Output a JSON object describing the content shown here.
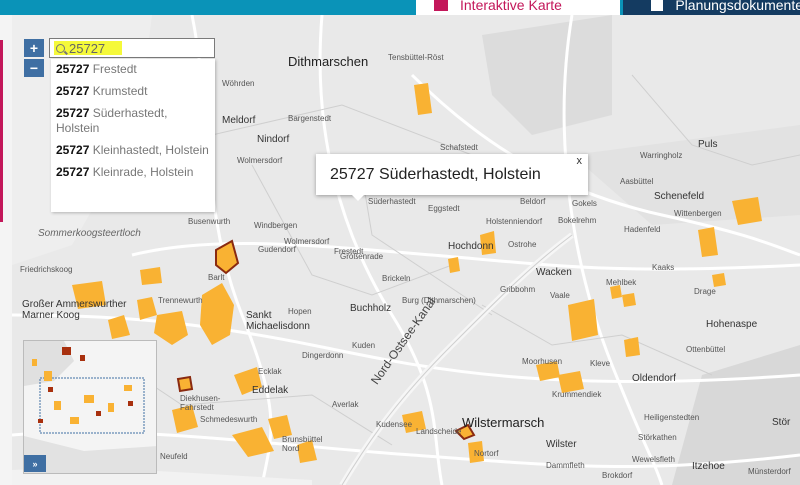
{
  "nav": {
    "tabs": [
      {
        "label": "Interaktive Karte",
        "active": true
      },
      {
        "label": "Planungsdokumente",
        "active": false
      }
    ]
  },
  "colors": {
    "accent": "#c3175a",
    "nav_bar": "#0a93b8",
    "nav_dark": "#143b61",
    "zone": "#f9b233",
    "search_highlight": "#f5f93a",
    "control": "#3f6fa3"
  },
  "controls": {
    "zoom_in": "+",
    "zoom_out": "−",
    "overview_toggle": "»"
  },
  "search": {
    "value": "25727",
    "icon": "search-icon"
  },
  "suggestions": [
    {
      "code": "25727",
      "name": "Frestedt"
    },
    {
      "code": "25727",
      "name": "Krumstedt"
    },
    {
      "code": "25727",
      "name": "Süderhastedt, Holstein"
    },
    {
      "code": "25727",
      "name": "Kleinhastedt, Holstein"
    },
    {
      "code": "25727",
      "name": "Kleinrade, Holstein"
    }
  ],
  "popup": {
    "title": "25727 Süderhastedt, Holstein",
    "close": "x"
  },
  "map": {
    "places": [
      {
        "name": "Dithmarschen",
        "size": "big"
      },
      {
        "name": "Tensbüttel-Röst",
        "size": "small"
      },
      {
        "name": "Wöhrden",
        "size": "small"
      },
      {
        "name": "Meldorf",
        "size": "mid"
      },
      {
        "name": "Nindorf",
        "size": "mid"
      },
      {
        "name": "Bargenstedt",
        "size": "small"
      },
      {
        "name": "Wolmersdorf",
        "size": "small"
      },
      {
        "name": "Schafstedt",
        "size": "small"
      },
      {
        "name": "Warringholz",
        "size": "small"
      },
      {
        "name": "Puls",
        "size": "mid"
      },
      {
        "name": "Aasbüttel",
        "size": "small"
      },
      {
        "name": "Schenefeld",
        "size": "mid"
      },
      {
        "name": "Süderhastedt",
        "size": "small"
      },
      {
        "name": "Eggstedt",
        "size": "small"
      },
      {
        "name": "Beldorf",
        "size": "small"
      },
      {
        "name": "Bokelrehm",
        "size": "small"
      },
      {
        "name": "Gokels",
        "size": "small"
      },
      {
        "name": "Holstenniendorf",
        "size": "small"
      },
      {
        "name": "Wittenbergen",
        "size": "small"
      },
      {
        "name": "Hadenfeld",
        "size": "small"
      },
      {
        "name": "Sommerkoogsteertloch",
        "size": "italic"
      },
      {
        "name": "Busenwurth",
        "size": "small"
      },
      {
        "name": "Windbergen",
        "size": "small"
      },
      {
        "name": "Wolmersdorf",
        "size": "small"
      },
      {
        "name": "Gudendorf",
        "size": "small"
      },
      {
        "name": "Frestedt",
        "size": "small"
      },
      {
        "name": "Hochdonn",
        "size": "mid"
      },
      {
        "name": "Ostrohe",
        "size": "small"
      },
      {
        "name": "Wacken",
        "size": "mid"
      },
      {
        "name": "Kaaks",
        "size": "small"
      },
      {
        "name": "Friedrichskoog",
        "size": "small"
      },
      {
        "name": "Barlt",
        "size": "small"
      },
      {
        "name": "Großenrade",
        "size": "small"
      },
      {
        "name": "Brickeln",
        "size": "small"
      },
      {
        "name": "Buchholz",
        "size": "mid"
      },
      {
        "name": "Burg (Dithmarschen)",
        "size": "small"
      },
      {
        "name": "Vaale",
        "size": "small"
      },
      {
        "name": "Mehlbek",
        "size": "small"
      },
      {
        "name": "Gribbohm",
        "size": "small"
      },
      {
        "name": "Drage",
        "size": "small"
      },
      {
        "name": "Hohenaspe",
        "size": "mid"
      },
      {
        "name": "Trennewurth",
        "size": "small"
      },
      {
        "name": "Hopen",
        "size": "small"
      },
      {
        "name": "Sankt Michaelisdonn",
        "size": "mid"
      },
      {
        "name": "Großer Ammerswurther Marner Koog",
        "size": "mid"
      },
      {
        "name": "Kuden",
        "size": "small"
      },
      {
        "name": "Averlak",
        "size": "small"
      },
      {
        "name": "Kudensee",
        "size": "small"
      },
      {
        "name": "Dingerdonn",
        "size": "small"
      },
      {
        "name": "Eddelak",
        "size": "mid"
      },
      {
        "name": "Brunsbüttel Nord",
        "size": "small"
      },
      {
        "name": "Nord-Ostsee-Kanal",
        "size": "region"
      },
      {
        "name": "Landscheide",
        "size": "small"
      },
      {
        "name": "Wilstermarsch",
        "size": "big"
      },
      {
        "name": "Wilster",
        "size": "mid"
      },
      {
        "name": "Kleve",
        "size": "small"
      },
      {
        "name": "Oldendorf",
        "size": "mid"
      },
      {
        "name": "Ottenbüttel",
        "size": "small"
      },
      {
        "name": "Itzehoe",
        "size": "mid"
      },
      {
        "name": "Heiligenstedten",
        "size": "small"
      },
      {
        "name": "Störkathen",
        "size": "small"
      },
      {
        "name": "Dammfleth",
        "size": "small"
      },
      {
        "name": "Krummendiek",
        "size": "small"
      },
      {
        "name": "Moorhusen",
        "size": "small"
      },
      {
        "name": "Schmedeswurth",
        "size": "small"
      },
      {
        "name": "Diekhusen-Fahrstedt",
        "size": "small"
      },
      {
        "name": "Neufeld",
        "size": "small"
      },
      {
        "name": "Ecklak",
        "size": "small"
      },
      {
        "name": "Nortorf",
        "size": "small"
      },
      {
        "name": "Brokdorf",
        "size": "small"
      },
      {
        "name": "Stör",
        "size": "mid"
      },
      {
        "name": "Münsterdorf",
        "size": "small"
      },
      {
        "name": "Wewelsfleth",
        "size": "small"
      }
    ]
  }
}
